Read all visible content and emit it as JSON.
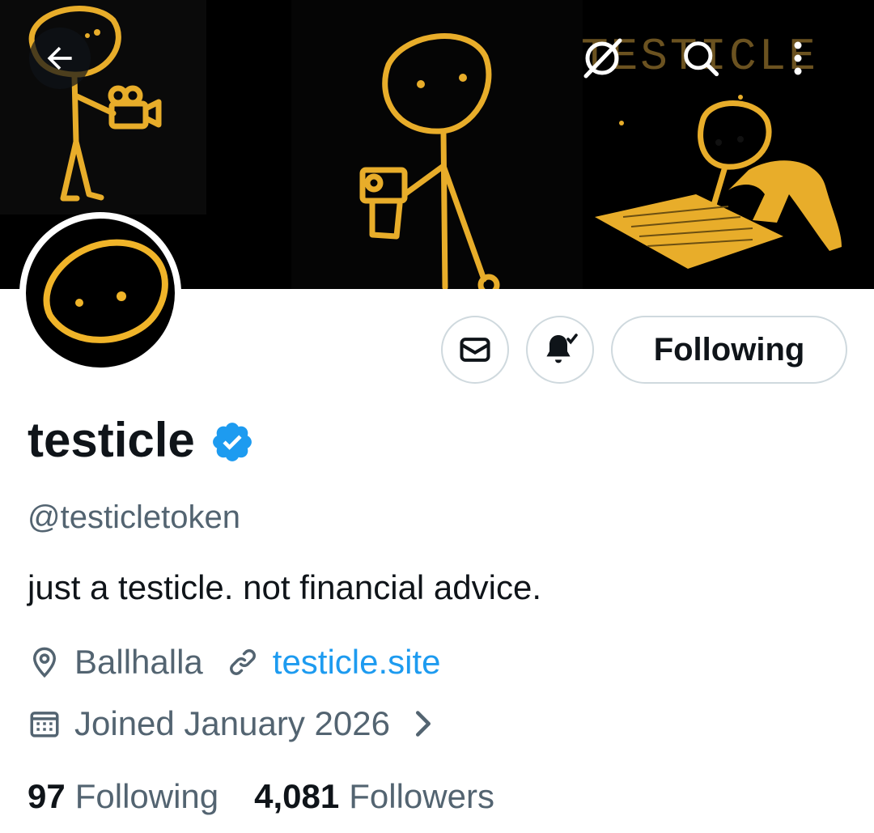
{
  "banner": {
    "wordmark": "TESTICLE"
  },
  "actions": {
    "following_label": "Following"
  },
  "profile": {
    "display_name": "testicle",
    "handle": "@testicletoken",
    "bio": "just a testicle. not financial advice.",
    "location": "Ballhalla",
    "website": "testicle.site",
    "joined": "Joined January 2026",
    "following_count": "97",
    "following_label": "Following",
    "followers_count": "4,081",
    "followers_label": "Followers"
  },
  "colors": {
    "accent": "#1d9bf0",
    "banner_yellow": "#f0b429",
    "text_primary": "#0f1419",
    "text_secondary": "#536471"
  },
  "icons": [
    "back-arrow-icon",
    "grok-icon",
    "search-icon",
    "more-icon",
    "mail-icon",
    "bell-icon",
    "verified-badge-icon",
    "location-icon",
    "link-icon",
    "calendar-icon",
    "chevron-right-icon"
  ]
}
